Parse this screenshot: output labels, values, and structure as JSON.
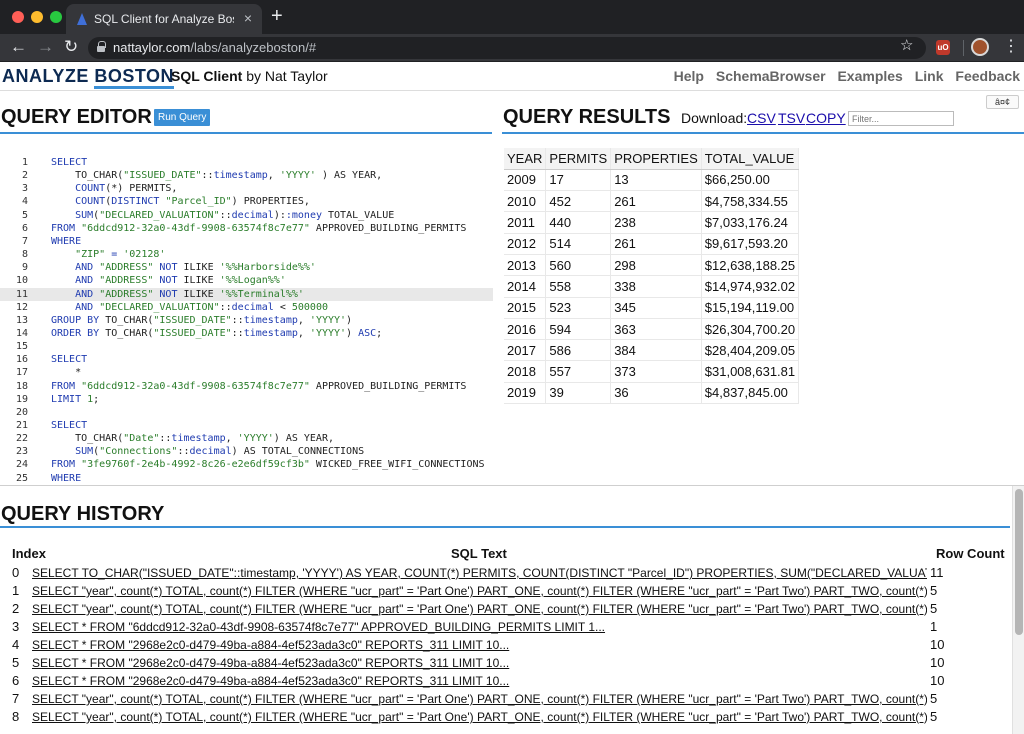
{
  "browser": {
    "tab_title": "SQL Client for Analyze Boston",
    "tab_close": "×",
    "new_tab": "+",
    "url_host": "nattaylor.com",
    "url_path": "/labs/analyzeboston/#",
    "extension_label": "uO",
    "icons": [
      "back-arrow-icon",
      "forward-arrow-icon",
      "reload-icon",
      "lock-icon",
      "star-icon",
      "ublock-icon",
      "profile-avatar-icon",
      "kebab-menu-icon"
    ]
  },
  "header": {
    "logo_analyze": "ANALYZE",
    "logo_boston": "BOSTON",
    "subtitle": "SQL Client",
    "byline": "by Nat Taylor",
    "nav": [
      "Help",
      "SchemaBrowser",
      "Examples",
      "Link",
      "Feedback"
    ],
    "encoding_button": "â¤¢"
  },
  "editor": {
    "title": "QUERY EDITOR",
    "run_button": "Run Query",
    "active_line": 11,
    "lines": [
      [
        [
          "kw",
          "SELECT"
        ]
      ],
      [
        [
          "",
          "    TO_CHAR("
        ],
        [
          "str",
          "\"ISSUED_DATE\""
        ],
        [
          "",
          "::"
        ],
        [
          "ty",
          "timestamp"
        ],
        [
          "",
          ", "
        ],
        [
          "str",
          "'YYYY'"
        ],
        [
          "",
          " ) AS YEAR,"
        ]
      ],
      [
        [
          "",
          "    "
        ],
        [
          "kw",
          "COUNT"
        ],
        [
          "",
          "(*) PERMITS,"
        ]
      ],
      [
        [
          "",
          "    "
        ],
        [
          "kw",
          "COUNT"
        ],
        [
          "",
          "("
        ],
        [
          "kw",
          "DISTINCT"
        ],
        [
          "",
          " "
        ],
        [
          "str",
          "\"Parcel_ID\""
        ],
        [
          "",
          ") PROPERTIES,"
        ]
      ],
      [
        [
          "",
          "    "
        ],
        [
          "kw",
          "SUM"
        ],
        [
          "",
          "("
        ],
        [
          "str",
          "\"DECLARED_VALUATION\""
        ],
        [
          "",
          "::"
        ],
        [
          "ty",
          "decimal"
        ],
        [
          "",
          "):"
        ],
        [
          "ty",
          ":money"
        ],
        [
          "",
          " TOTAL_VALUE"
        ]
      ],
      [
        [
          "kw",
          "FROM"
        ],
        [
          "",
          " "
        ],
        [
          "str",
          "\"6ddcd912-32a0-43df-9908-63574f8c7e77\""
        ],
        [
          "",
          " APPROVED_BUILDING_PERMITS"
        ]
      ],
      [
        [
          "kw",
          "WHERE"
        ]
      ],
      [
        [
          "",
          "    "
        ],
        [
          "str",
          "\"ZIP\""
        ],
        [
          "kw",
          " = "
        ],
        [
          "str",
          "'02128'"
        ]
      ],
      [
        [
          "",
          "    "
        ],
        [
          "kw",
          "AND"
        ],
        [
          "",
          " "
        ],
        [
          "str",
          "\"ADDRESS\""
        ],
        [
          "",
          " "
        ],
        [
          "kw",
          "NOT"
        ],
        [
          "",
          " ILIKE "
        ],
        [
          "str",
          "'%%Harborside%%'"
        ]
      ],
      [
        [
          "",
          "    "
        ],
        [
          "kw",
          "AND"
        ],
        [
          "",
          " "
        ],
        [
          "str",
          "\"ADDRESS\""
        ],
        [
          "",
          " "
        ],
        [
          "kw",
          "NOT"
        ],
        [
          "",
          " ILIKE "
        ],
        [
          "str",
          "'%%Logan%%'"
        ]
      ],
      [
        [
          "",
          "    "
        ],
        [
          "kw",
          "AND"
        ],
        [
          "",
          " "
        ],
        [
          "str",
          "\"ADDRESS\""
        ],
        [
          "",
          " "
        ],
        [
          "kw",
          "NOT"
        ],
        [
          "",
          " ILIKE "
        ],
        [
          "str",
          "'%%Terminal%%'"
        ]
      ],
      [
        [
          "",
          "    "
        ],
        [
          "kw",
          "AND"
        ],
        [
          "",
          " "
        ],
        [
          "str",
          "\"DECLARED_VALUATION\""
        ],
        [
          "",
          "::"
        ],
        [
          "ty",
          "decimal"
        ],
        [
          "",
          " < "
        ],
        [
          "str",
          "500000"
        ]
      ],
      [
        [
          "kw",
          "GROUP BY"
        ],
        [
          "",
          " TO_CHAR("
        ],
        [
          "str",
          "\"ISSUED_DATE\""
        ],
        [
          "",
          "::"
        ],
        [
          "ty",
          "timestamp"
        ],
        [
          "",
          ", "
        ],
        [
          "str",
          "'YYYY'"
        ],
        [
          "",
          ")"
        ]
      ],
      [
        [
          "kw",
          "ORDER BY"
        ],
        [
          "",
          " TO_CHAR("
        ],
        [
          "str",
          "\"ISSUED_DATE\""
        ],
        [
          "",
          "::"
        ],
        [
          "ty",
          "timestamp"
        ],
        [
          "",
          ", "
        ],
        [
          "str",
          "'YYYY'"
        ],
        [
          "",
          ") "
        ],
        [
          "kw",
          "ASC"
        ],
        [
          "",
          ";"
        ]
      ],
      [],
      [
        [
          "kw",
          "SELECT"
        ]
      ],
      [
        [
          "",
          "    *"
        ]
      ],
      [
        [
          "kw",
          "FROM"
        ],
        [
          "",
          " "
        ],
        [
          "str",
          "\"6ddcd912-32a0-43df-9908-63574f8c7e77\""
        ],
        [
          "",
          " APPROVED_BUILDING_PERMITS"
        ]
      ],
      [
        [
          "kw",
          "LIMIT"
        ],
        [
          "",
          " "
        ],
        [
          "str",
          "1"
        ],
        [
          "",
          ";"
        ]
      ],
      [],
      [
        [
          "kw",
          "SELECT"
        ]
      ],
      [
        [
          "",
          "    TO_CHAR("
        ],
        [
          "str",
          "\"Date\""
        ],
        [
          "",
          "::"
        ],
        [
          "ty",
          "timestamp"
        ],
        [
          "",
          ", "
        ],
        [
          "str",
          "'YYYY'"
        ],
        [
          "",
          ") AS YEAR,"
        ]
      ],
      [
        [
          "",
          "    "
        ],
        [
          "kw",
          "SUM"
        ],
        [
          "",
          "("
        ],
        [
          "str",
          "\"Connections\""
        ],
        [
          "",
          "::"
        ],
        [
          "ty",
          "decimal"
        ],
        [
          "",
          ") AS TOTAL_CONNECTIONS"
        ]
      ],
      [
        [
          "kw",
          "FROM"
        ],
        [
          "",
          " "
        ],
        [
          "str",
          "\"3fe9760f-2e4b-4992-8c26-e2e6df59cf3b\""
        ],
        [
          "",
          " WICKED_FREE_WIFI_CONNECTIONS"
        ]
      ],
      [
        [
          "kw",
          "WHERE"
        ]
      ]
    ]
  },
  "results": {
    "title": "QUERY RESULTS",
    "download_label": "Download:",
    "download_links": [
      "CSV",
      "TSV",
      "COPY"
    ],
    "filter_placeholder": "Filter...",
    "columns": [
      "YEAR",
      "PERMITS",
      "PROPERTIES",
      "TOTAL_VALUE"
    ],
    "rows": [
      [
        "2009",
        "17",
        "13",
        "$66,250.00"
      ],
      [
        "2010",
        "452",
        "261",
        "$4,758,334.55"
      ],
      [
        "2011",
        "440",
        "238",
        "$7,033,176.24"
      ],
      [
        "2012",
        "514",
        "261",
        "$9,617,593.20"
      ],
      [
        "2013",
        "560",
        "298",
        "$12,638,188.25"
      ],
      [
        "2014",
        "558",
        "338",
        "$14,974,932.02"
      ],
      [
        "2015",
        "523",
        "345",
        "$15,194,119.00"
      ],
      [
        "2016",
        "594",
        "363",
        "$26,304,700.20"
      ],
      [
        "2017",
        "586",
        "384",
        "$28,404,209.05"
      ],
      [
        "2018",
        "557",
        "373",
        "$31,008,631.81"
      ],
      [
        "2019",
        "39",
        "36",
        "$4,837,845.00"
      ]
    ]
  },
  "history": {
    "title": "QUERY HISTORY",
    "columns": [
      "Index",
      "SQL Text",
      "Row Count"
    ],
    "rows": [
      {
        "index": "0",
        "sql": "SELECT TO_CHAR(\"ISSUED_DATE\"::timestamp, 'YYYY') AS YEAR, COUNT(*) PERMITS, COUNT(DISTINCT \"Parcel_ID\") PROPERTIES, SUM(\"DECLARED_VALUATION\"::decim...",
        "count": "11"
      },
      {
        "index": "1",
        "sql": "SELECT \"year\", count(*) TOTAL, count(*) FILTER (WHERE \"ucr_part\" = 'Part One') PART_ONE, count(*) FILTER (WHERE \"ucr_part\" = 'Part Two') PART_TWO, count(*) FILTER (W...",
        "count": "5"
      },
      {
        "index": "2",
        "sql": "SELECT \"year\", count(*) TOTAL, count(*) FILTER (WHERE \"ucr_part\" = 'Part One') PART_ONE, count(*) FILTER (WHERE \"ucr_part\" = 'Part Two') PART_TWO, count(*) FILTER (W...",
        "count": "5"
      },
      {
        "index": "3",
        "sql": "SELECT * FROM \"6ddcd912-32a0-43df-9908-63574f8c7e77\" APPROVED_BUILDING_PERMITS LIMIT 1...",
        "count": "1"
      },
      {
        "index": "4",
        "sql": "SELECT * FROM \"2968e2c0-d479-49ba-a884-4ef523ada3c0\" REPORTS_311 LIMIT 10...",
        "count": "10"
      },
      {
        "index": "5",
        "sql": "SELECT * FROM \"2968e2c0-d479-49ba-a884-4ef523ada3c0\" REPORTS_311 LIMIT 10...",
        "count": "10"
      },
      {
        "index": "6",
        "sql": "SELECT * FROM \"2968e2c0-d479-49ba-a884-4ef523ada3c0\" REPORTS_311 LIMIT 10...",
        "count": "10"
      },
      {
        "index": "7",
        "sql": "SELECT \"year\", count(*) TOTAL, count(*) FILTER (WHERE \"ucr_part\" = 'Part One') PART_ONE, count(*) FILTER (WHERE \"ucr_part\" = 'Part Two') PART_TWO, count(*) FILTER (W...",
        "count": "5"
      },
      {
        "index": "8",
        "sql": "SELECT \"year\", count(*) TOTAL, count(*) FILTER (WHERE \"ucr_part\" = 'Part One') PART_ONE, count(*) FILTER (WHERE \"ucr_part\" = 'Part Two') PART_TWO, count(*) FILTER (W...",
        "count": "5"
      }
    ]
  },
  "colors": {
    "accent": "#3a8fd6",
    "keyword": "#1f3bb0",
    "string": "#2a7d2a"
  }
}
